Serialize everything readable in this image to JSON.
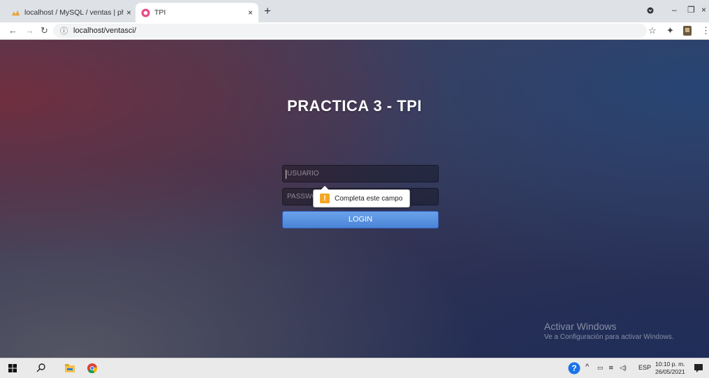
{
  "browser": {
    "tabs": [
      {
        "title": "localhost / MySQL / ventas | php",
        "active": false
      },
      {
        "title": "TPI",
        "active": true
      }
    ],
    "close_glyph": "×",
    "new_tab_glyph": "+",
    "address": "localhost/ventasci/",
    "window_controls": [
      "–",
      "❐",
      "×"
    ]
  },
  "page": {
    "heading": "PRACTICA 3 - TPI",
    "username_placeholder": "USUARIO",
    "password_placeholder": "PASSWORD",
    "login_label": "LOGIN",
    "tooltip_text": "Completa este campo",
    "tooltip_icon": "!"
  },
  "watermark": {
    "title": "Activar Windows",
    "subtitle": "Ve a Configuración para activar Windows."
  },
  "taskbar": {
    "language": "ESP",
    "time": "10:10 p. m.",
    "date": "26/05/2021"
  },
  "colors": {
    "login_button": "#4a84d6",
    "warning_icon": "#f5a623"
  }
}
